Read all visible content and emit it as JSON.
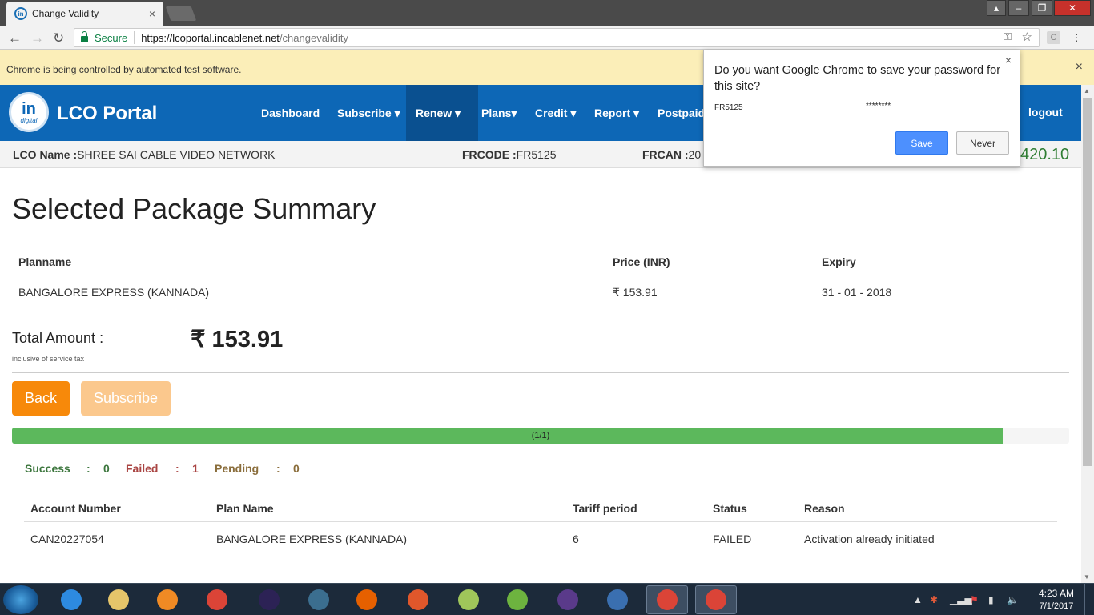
{
  "browser": {
    "tab_title": "Change Validity",
    "tab_close": "×",
    "secure_label": "Secure",
    "url_host": "https://lcoportal.incablenet.net",
    "url_path": "/changevalidity",
    "infobar_text": "Chrome is being controlled by automated test software.",
    "infobar_close": "×"
  },
  "password_bubble": {
    "question": "Do you want Google Chrome to save your password for this site?",
    "username": "FR5125",
    "password": "********",
    "save_label": "Save",
    "never_label": "Never",
    "close": "×"
  },
  "navbar": {
    "brand_logo_text": "in",
    "brand_logo_sub": "digital",
    "brand_name": "LCO Portal",
    "items": [
      {
        "label": "Dashboard"
      },
      {
        "label": "Subscribe ▾"
      },
      {
        "label": "Renew ▾"
      },
      {
        "label": "Plans▾"
      },
      {
        "label": "Credit ▾"
      },
      {
        "label": "Report ▾"
      },
      {
        "label": "Postpaid"
      }
    ],
    "logout_label": "logout"
  },
  "infostrip": {
    "lco_label": "LCO Name :",
    "lco_value": "SHREE SAI CABLE VIDEO NETWORK",
    "frcode_label": "FRCODE :",
    "frcode_value": "FR5125",
    "frcan_label": "FRCAN :",
    "frcan_value": "20",
    "balance": "420.10"
  },
  "summary": {
    "title": "Selected Package Summary",
    "columns": [
      "Planname",
      "Price (INR)",
      "Expiry"
    ],
    "rows": [
      [
        "BANGALORE EXPRESS (KANNADA)",
        "₹ 153.91",
        "31 - 01 - 2018"
      ]
    ],
    "total_label": "Total Amount :",
    "total_note": "inclusive of service tax",
    "total_value": "₹ 153.91"
  },
  "actions": {
    "back_label": "Back",
    "subscribe_label": "Subscribe"
  },
  "progress": {
    "text": "(1/1)",
    "fraction": 0.937,
    "color": "#5cb85c"
  },
  "status_counts": {
    "success_label": "Success",
    "success_value": "0",
    "failed_label": "Failed",
    "failed_value": "1",
    "pending_label": "Pending",
    "pending_value": "0",
    "separator": ":"
  },
  "results": {
    "columns": [
      "Account Number",
      "Plan Name",
      "Tariff period",
      "Status",
      "Reason"
    ],
    "rows": [
      [
        "CAN20227054",
        "BANGALORE EXPRESS (KANNADA)",
        "6",
        "FAILED",
        "Activation already initiated"
      ]
    ]
  },
  "taskbar": {
    "apps": [
      {
        "icon": "internet-explorer-icon",
        "color": "#2d8ae0"
      },
      {
        "icon": "file-explorer-icon",
        "color": "#e5c56a"
      },
      {
        "icon": "media-player-icon",
        "color": "#f08a24"
      },
      {
        "icon": "chrome-icon",
        "color": "#db4437"
      },
      {
        "icon": "eclipse-icon",
        "color": "#2c2255"
      },
      {
        "icon": "mysql-workbench-icon",
        "color": "#3b6e8f"
      },
      {
        "icon": "firefox-icon",
        "color": "#e66000"
      },
      {
        "icon": "tool-icon",
        "color": "#e0572b"
      },
      {
        "icon": "folder-notes-icon",
        "color": "#9fc65a"
      },
      {
        "icon": "utorrent-icon",
        "color": "#6db33f"
      },
      {
        "icon": "java-ee-ide-icon",
        "color": "#5a3a8a"
      },
      {
        "icon": "settings-globe-icon",
        "color": "#3a6fb0"
      },
      {
        "icon": "chrome-icon",
        "color": "#db4437"
      },
      {
        "icon": "chrome-icon",
        "color": "#db4437"
      }
    ],
    "time": "4:23 AM",
    "date": "7/1/2017"
  }
}
